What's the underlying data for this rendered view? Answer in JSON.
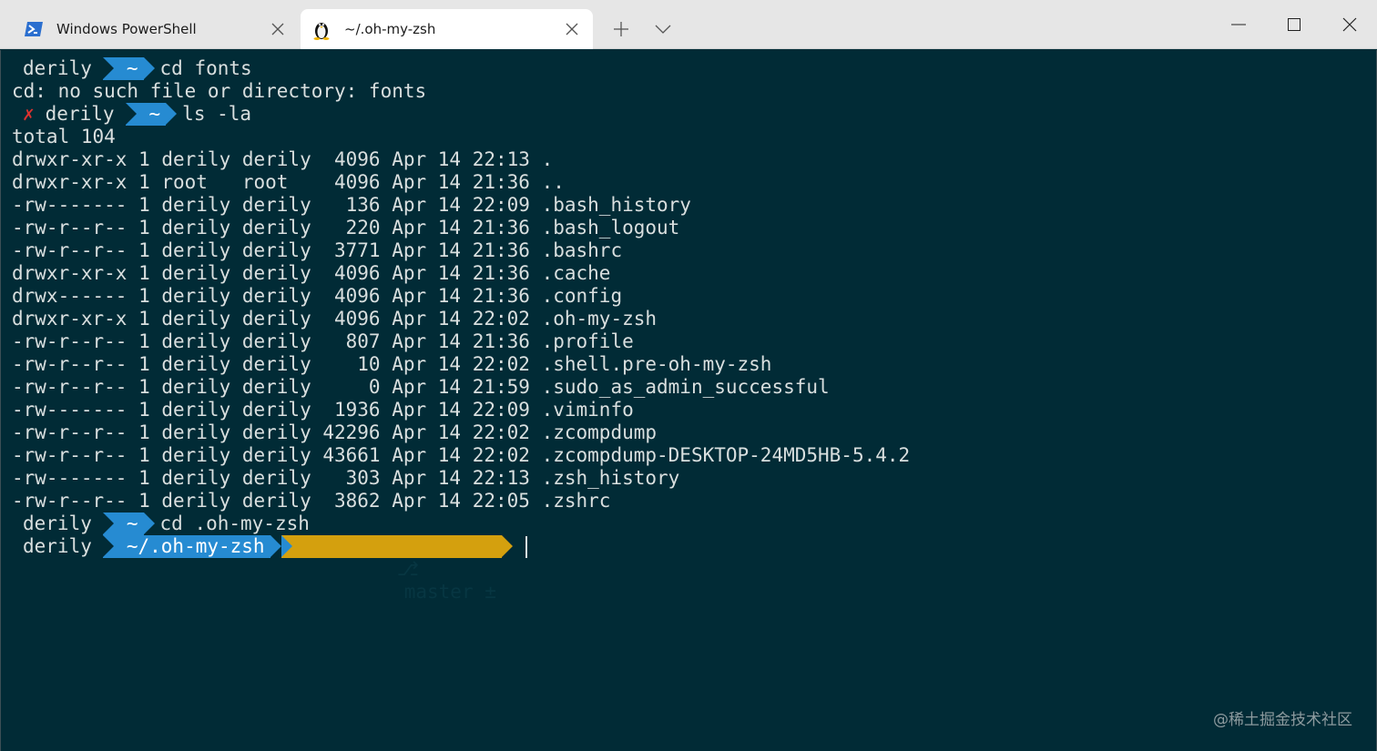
{
  "tabs": [
    {
      "title": "Windows PowerShell",
      "icon": "powershell-icon",
      "active": false
    },
    {
      "title": "~/.oh-my-zsh",
      "icon": "linux-penguin-icon",
      "active": true
    }
  ],
  "tab_actions": {
    "new_tab": "plus-icon",
    "dropdown": "chevron-down-icon"
  },
  "window_controls": [
    "minimize-icon",
    "maximize-icon",
    "close-icon"
  ],
  "colors": {
    "terminal_bg": "#012b36",
    "dir_segment": "#268bd2",
    "git_segment": "#d4a00e",
    "error_mark": "#dc322f",
    "text": "#d9dfdf"
  },
  "terminal": {
    "prompt1": {
      "user": "derily",
      "dir": "~",
      "cmd": "cd fonts"
    },
    "error_line": "cd: no such file or directory: fonts",
    "prompt2": {
      "mark": "✗",
      "user": "derily",
      "dir": "~",
      "cmd": "ls -la"
    },
    "total": "total 104",
    "listing": [
      "drwxr-xr-x 1 derily derily  4096 Apr 14 22:13 .",
      "drwxr-xr-x 1 root   root    4096 Apr 14 21:36 ..",
      "-rw------- 1 derily derily   136 Apr 14 22:09 .bash_history",
      "-rw-r--r-- 1 derily derily   220 Apr 14 21:36 .bash_logout",
      "-rw-r--r-- 1 derily derily  3771 Apr 14 21:36 .bashrc",
      "drwxr-xr-x 1 derily derily  4096 Apr 14 21:36 .cache",
      "drwx------ 1 derily derily  4096 Apr 14 21:36 .config",
      "drwxr-xr-x 1 derily derily  4096 Apr 14 22:02 .oh-my-zsh",
      "-rw-r--r-- 1 derily derily   807 Apr 14 21:36 .profile",
      "-rw-r--r-- 1 derily derily    10 Apr 14 22:02 .shell.pre-oh-my-zsh",
      "-rw-r--r-- 1 derily derily     0 Apr 14 21:59 .sudo_as_admin_successful",
      "-rw------- 1 derily derily  1936 Apr 14 22:09 .viminfo",
      "-rw-r--r-- 1 derily derily 42296 Apr 14 22:02 .zcompdump",
      "-rw-r--r-- 1 derily derily 43661 Apr 14 22:02 .zcompdump-DESKTOP-24MD5HB-5.4.2",
      "-rw------- 1 derily derily   303 Apr 14 22:13 .zsh_history",
      "-rw-r--r-- 1 derily derily  3862 Apr 14 22:05 .zshrc"
    ],
    "prompt3": {
      "user": "derily",
      "dir": "~",
      "cmd": "cd .oh-my-zsh"
    },
    "prompt4": {
      "user": "derily",
      "dir": "~/.oh-my-zsh",
      "branch_icon": "⎇",
      "branch": "master ±"
    }
  },
  "watermark": "@稀土掘金技术社区"
}
